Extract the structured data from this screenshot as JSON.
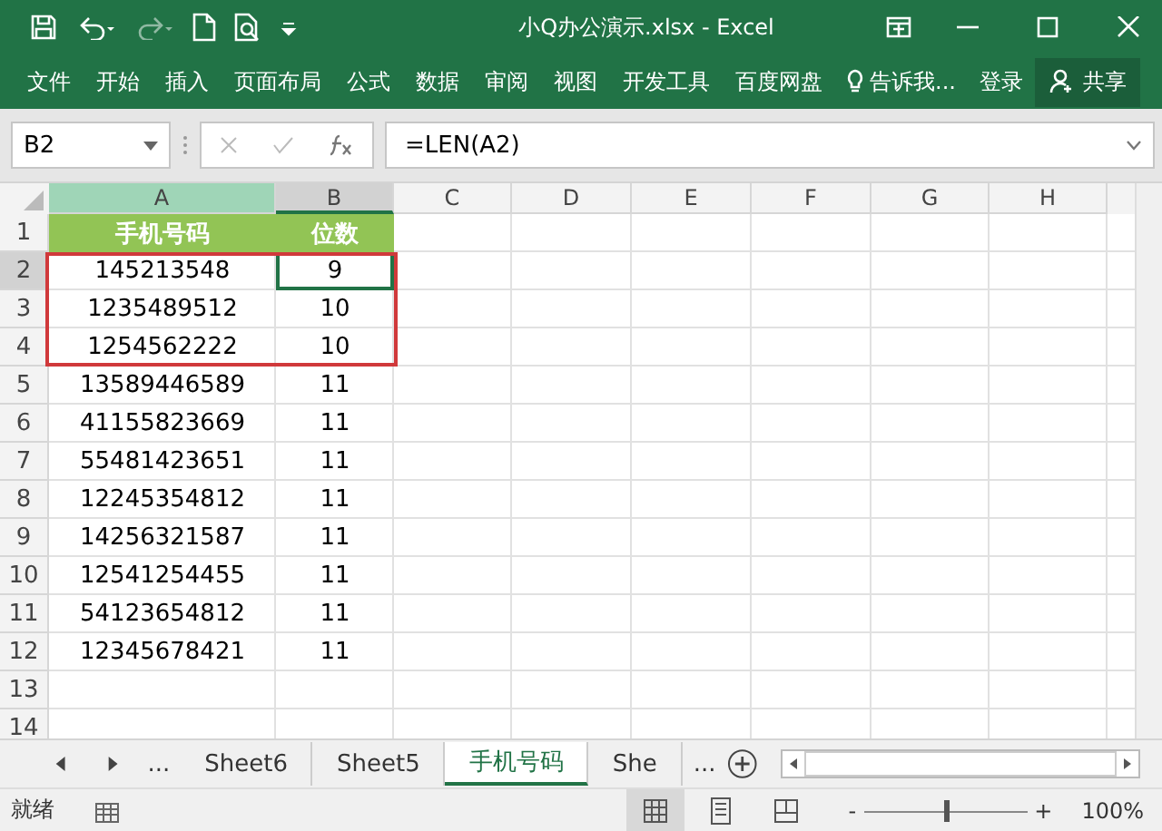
{
  "window": {
    "title": "小Q办公演示.xlsx - Excel"
  },
  "ribbon": {
    "tabs": [
      {
        "label": "文件",
        "selected": false
      },
      {
        "label": "开始",
        "selected": false
      },
      {
        "label": "插入",
        "selected": false
      },
      {
        "label": "页面布局",
        "selected": false
      },
      {
        "label": "公式",
        "selected": false
      },
      {
        "label": "数据",
        "selected": false
      },
      {
        "label": "审阅",
        "selected": false
      },
      {
        "label": "视图",
        "selected": false
      },
      {
        "label": "开发工具",
        "selected": false
      },
      {
        "label": "百度网盘",
        "selected": false
      }
    ],
    "tell_me": "告诉我...",
    "sign_in": "登录",
    "share": "共享"
  },
  "formula_bar": {
    "name_box": "B2",
    "formula": "=LEN(A2)"
  },
  "grid": {
    "columns": [
      {
        "label": "A",
        "highlighted": true,
        "selected": false
      },
      {
        "label": "B",
        "highlighted": false,
        "selected": true
      },
      {
        "label": "C",
        "highlighted": false,
        "selected": false
      },
      {
        "label": "D",
        "highlighted": false,
        "selected": false
      },
      {
        "label": "E",
        "highlighted": false,
        "selected": false
      },
      {
        "label": "F",
        "highlighted": false,
        "selected": false
      },
      {
        "label": "G",
        "highlighted": false,
        "selected": false
      },
      {
        "label": "H",
        "highlighted": false,
        "selected": false
      }
    ],
    "title_row": {
      "number": "1",
      "cells": [
        "手机号码",
        "位数"
      ]
    },
    "rows": [
      {
        "number": "2",
        "selected": true,
        "outlined": true,
        "cells": [
          "145213548",
          "9"
        ]
      },
      {
        "number": "3",
        "selected": false,
        "outlined": true,
        "cells": [
          "1235489512",
          "10"
        ]
      },
      {
        "number": "4",
        "selected": false,
        "outlined": true,
        "cells": [
          "1254562222",
          "10"
        ]
      },
      {
        "number": "5",
        "selected": false,
        "outlined": false,
        "cells": [
          "13589446589",
          "11"
        ]
      },
      {
        "number": "6",
        "selected": false,
        "outlined": false,
        "cells": [
          "41155823669",
          "11"
        ]
      },
      {
        "number": "7",
        "selected": false,
        "outlined": false,
        "cells": [
          "55481423651",
          "11"
        ]
      },
      {
        "number": "8",
        "selected": false,
        "outlined": false,
        "cells": [
          "12245354812",
          "11"
        ]
      },
      {
        "number": "9",
        "selected": false,
        "outlined": false,
        "cells": [
          "14256321587",
          "11"
        ]
      },
      {
        "number": "10",
        "selected": false,
        "outlined": false,
        "cells": [
          "12541254455",
          "11"
        ]
      },
      {
        "number": "11",
        "selected": false,
        "outlined": false,
        "cells": [
          "54123654812",
          "11"
        ]
      },
      {
        "number": "12",
        "selected": false,
        "outlined": false,
        "cells": [
          "12345678421",
          "11"
        ]
      },
      {
        "number": "13",
        "selected": false,
        "outlined": false,
        "cells": []
      },
      {
        "number": "14",
        "selected": false,
        "outlined": false,
        "cells": []
      }
    ]
  },
  "sheet_tabs": [
    {
      "label": "...",
      "selected": false
    },
    {
      "label": "Sheet6",
      "selected": false
    },
    {
      "label": "Sheet5",
      "selected": false
    },
    {
      "label": "手机号码",
      "selected": true
    },
    {
      "label": "She",
      "selected": false
    },
    {
      "label": "...",
      "selected": false
    }
  ],
  "status_bar": {
    "status": "就绪",
    "views": [
      {
        "kind": "normal",
        "selected": true
      },
      {
        "kind": "page_layout",
        "selected": false
      },
      {
        "kind": "page_break",
        "selected": false
      }
    ],
    "zoom": {
      "minus": "-",
      "plus": "+",
      "level": 0.5,
      "reading": "100%"
    }
  }
}
